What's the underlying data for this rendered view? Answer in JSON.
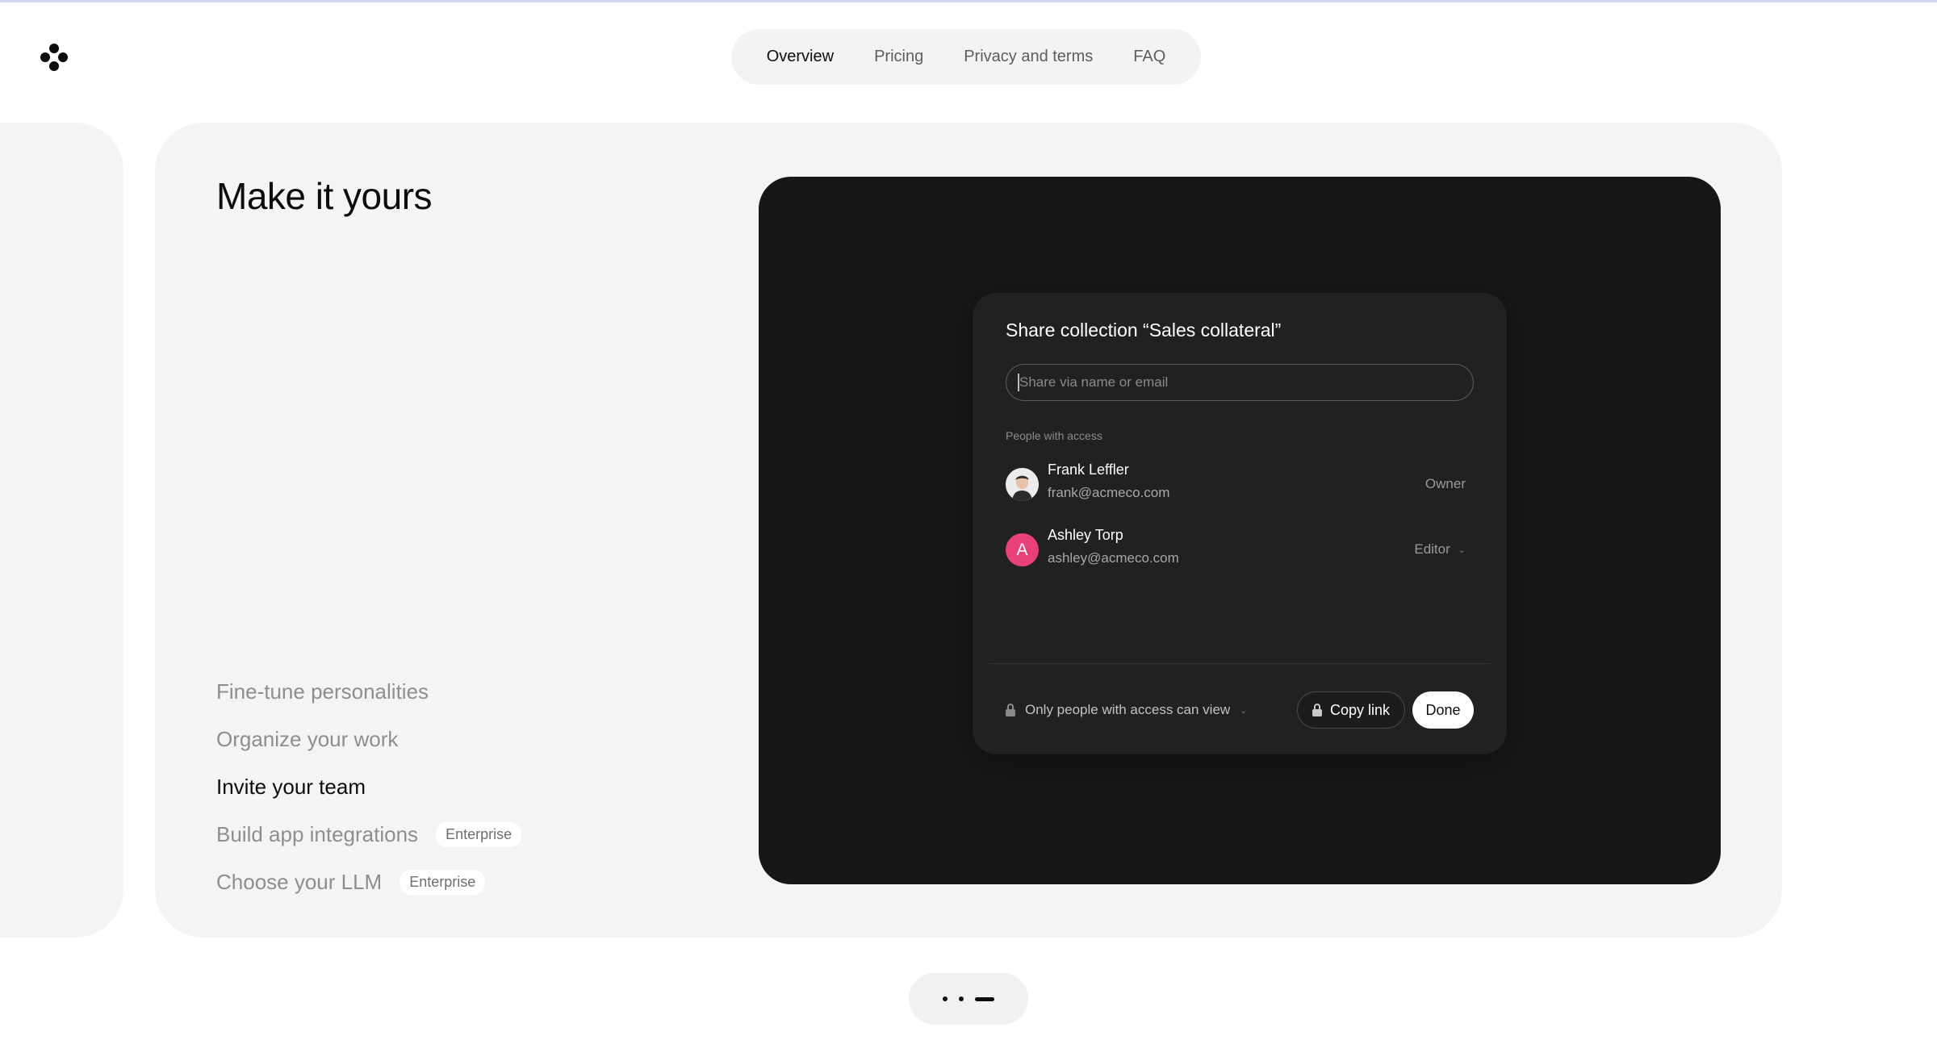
{
  "nav": {
    "items": [
      {
        "label": "Overview",
        "active": true
      },
      {
        "label": "Pricing",
        "active": false
      },
      {
        "label": "Privacy and terms",
        "active": false
      },
      {
        "label": "FAQ",
        "active": false
      }
    ]
  },
  "card": {
    "title": "Make it yours",
    "features": [
      {
        "label": "Fine-tune personalities",
        "badge": "",
        "active": false
      },
      {
        "label": "Organize your work",
        "badge": "",
        "active": false
      },
      {
        "label": "Invite your team",
        "badge": "",
        "active": true
      },
      {
        "label": "Build app integrations",
        "badge": "Enterprise",
        "active": false
      },
      {
        "label": "Choose your LLM",
        "badge": "Enterprise",
        "active": false
      }
    ]
  },
  "dialog": {
    "title": "Share collection “Sales collateral”",
    "input_placeholder": "Share via name or email",
    "people_label": "People with access",
    "people": [
      {
        "name": "Frank Leffler",
        "email": "frank@acmeco.com",
        "role": "Owner",
        "avatar": "photo"
      },
      {
        "name": "Ashley Torp",
        "email": "ashley@acmeco.com",
        "role": "Editor",
        "avatar": "A",
        "avatar_color": "#e8417a"
      }
    ],
    "access_label": "Only people with access can view",
    "copy_label": "Copy link",
    "done_label": "Done"
  },
  "pager": {
    "count": 3,
    "active_index": 2
  },
  "colors": {
    "panel_dark": "#171717",
    "dialog_bg": "#212121",
    "card_bg": "#f4f4f4",
    "accent_pink": "#e8417a"
  }
}
